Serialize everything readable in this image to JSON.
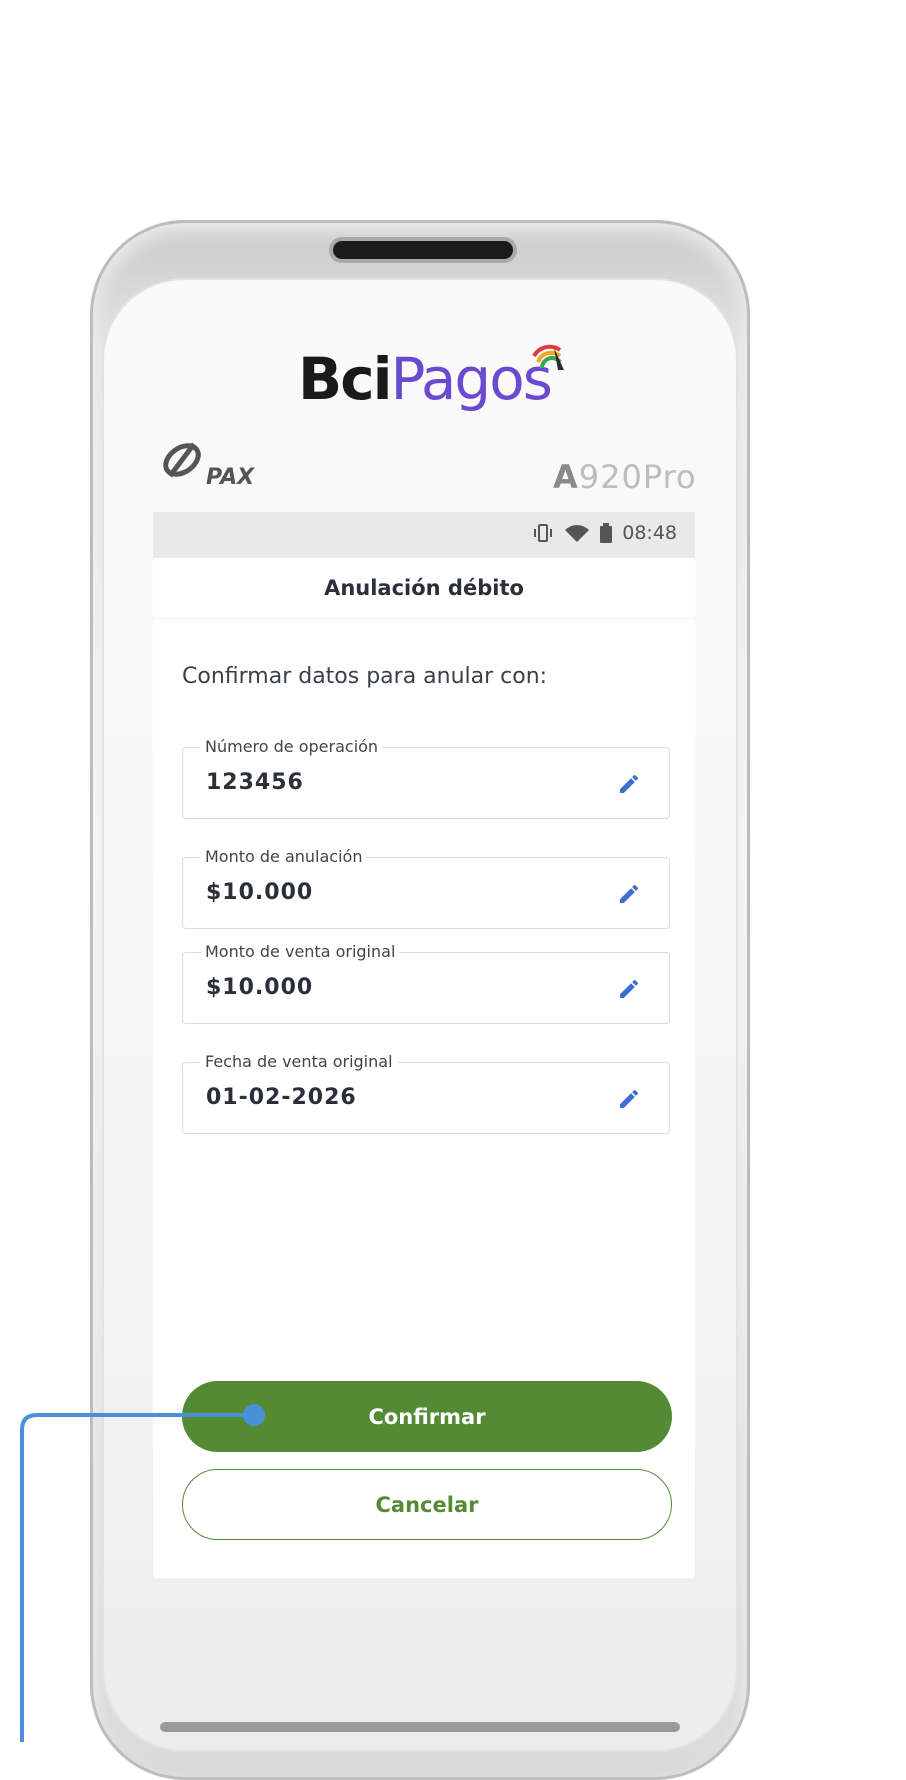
{
  "brand": {
    "part1": "Bci",
    "part2": "Pagos"
  },
  "device": {
    "maker": "PAX",
    "model_bold": "A",
    "model_rest": "920Pro"
  },
  "status_bar": {
    "time": "08:48"
  },
  "app_bar": {
    "title": "Anulación débito"
  },
  "prompt": "Confirmar datos para anular con:",
  "fields": [
    {
      "label": "Número de operación",
      "value": "123456"
    },
    {
      "label": "Monto de anulación",
      "value": "$10.000"
    },
    {
      "label": "Monto de venta original",
      "value": "$10.000"
    },
    {
      "label": "Fecha de venta original",
      "value": "01-02-2026"
    }
  ],
  "buttons": {
    "confirm": "Confirmar",
    "cancel": "Cancelar"
  },
  "colors": {
    "primary_green": "#548a34",
    "brand_purple": "#6a4bd0",
    "edit_icon_blue": "#3b6fd1",
    "callout_blue": "#4a90d9"
  },
  "icons": [
    "vibrate-icon",
    "wifi-icon",
    "battery-icon",
    "edit-icon"
  ]
}
